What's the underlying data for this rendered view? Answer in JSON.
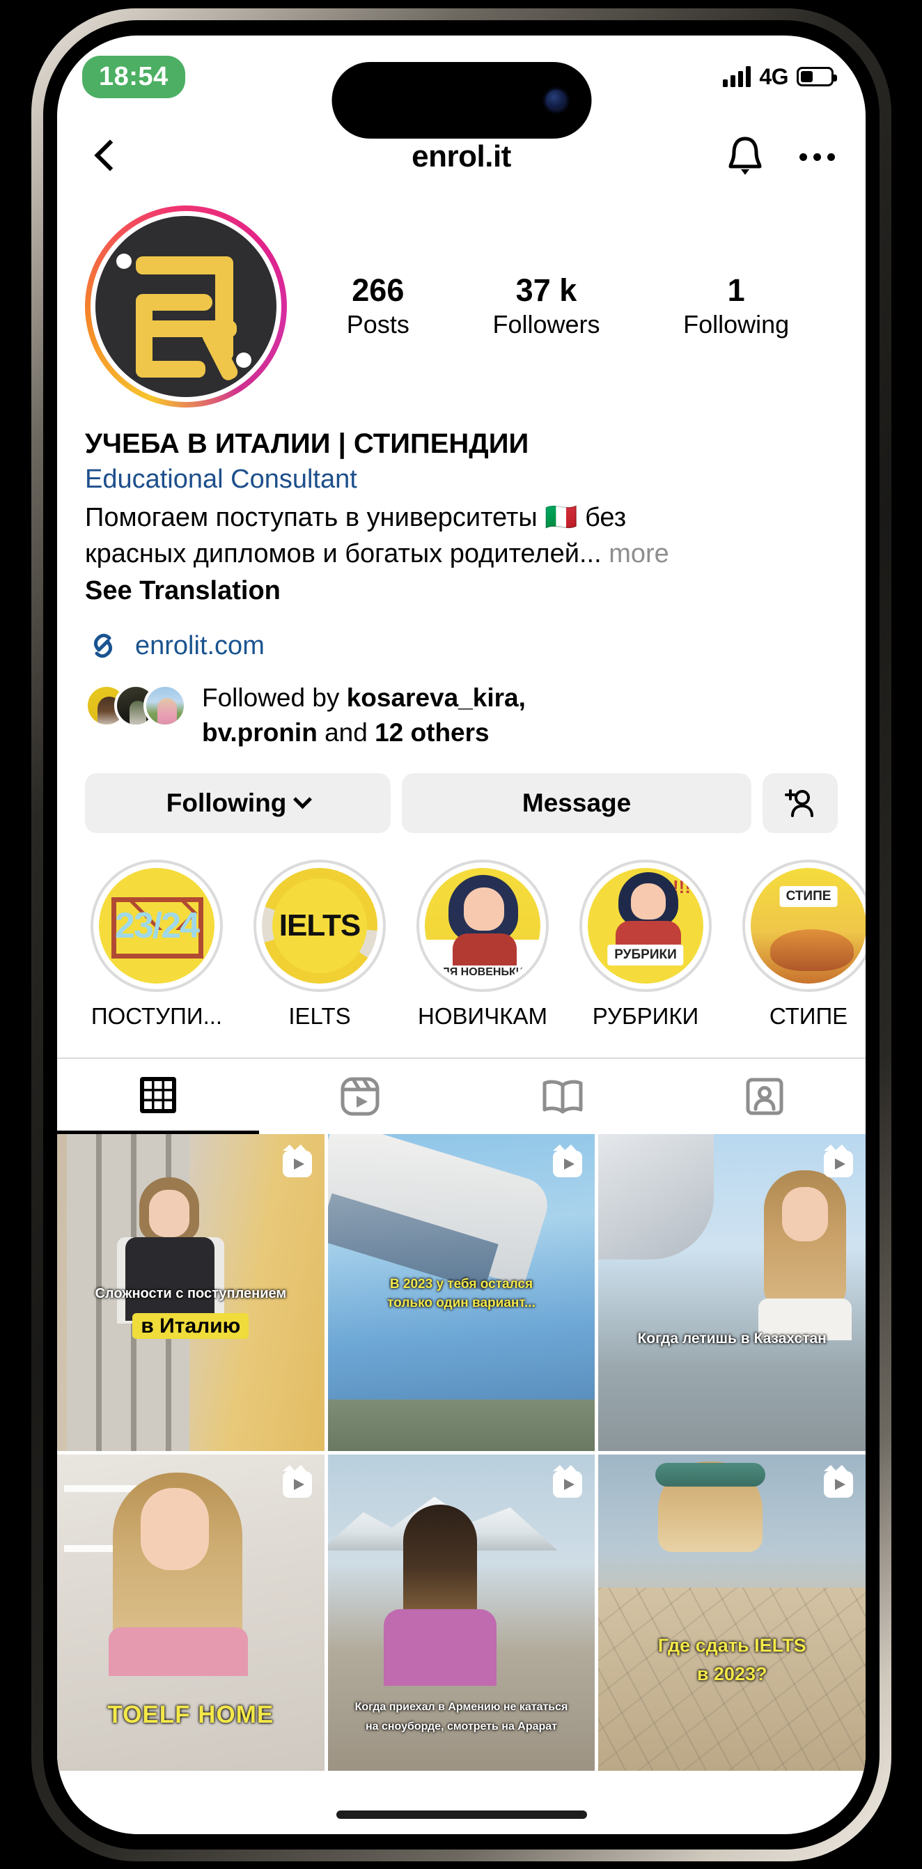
{
  "status_bar": {
    "time": "18:54",
    "network": "4G",
    "signal_icon": "signal-bars-icon",
    "battery_icon": "battery-icon"
  },
  "header": {
    "back_icon": "back-chevron-icon",
    "username": "enrol.it",
    "bell_icon": "bell-icon",
    "more_icon": "more-options-icon"
  },
  "profile": {
    "avatar_name": "enrol-it-avatar",
    "stats": [
      {
        "value": "266",
        "label": "Posts"
      },
      {
        "value": "37 k",
        "label": "Followers"
      },
      {
        "value": "1",
        "label": "Following"
      }
    ],
    "display_name": "УЧЕБА В ИТАЛИИ | СТИПЕНДИИ",
    "category": "Educational Consultant",
    "bio_line1": "Помогаем поступать в университеты 🇮🇹 без",
    "bio_line2": "красных дипломов и богатых родителей...",
    "bio_more": " more",
    "see_translation": "See Translation",
    "link_icon": "link-icon",
    "link_text": "enrolit.com",
    "followed_by_prefix": "Followed by ",
    "followed_by_names": "kosareva_kira, bv.pronin",
    "followed_by_and": " and ",
    "followed_by_others": "12 others"
  },
  "actions": {
    "following_label": "Following",
    "following_chevron": "chevron-down-icon",
    "message_label": "Message",
    "add_person_icon": "add-person-icon"
  },
  "highlights": [
    {
      "label": "ПОСТУПИ...",
      "art": "23/24"
    },
    {
      "label": "IELTS",
      "art": "IELTS"
    },
    {
      "label": "НОВИЧКАМ",
      "art": "ДЛЯ НОВЕНЬКИХ"
    },
    {
      "label": "РУБРИКИ",
      "art": "РУБРИКИ"
    },
    {
      "label": "СТИПЕ",
      "art": "СТИПЕ"
    }
  ],
  "tabs": [
    {
      "name": "grid",
      "icon": "grid-icon",
      "active": true
    },
    {
      "name": "reels",
      "icon": "reels-icon",
      "active": false
    },
    {
      "name": "guides",
      "icon": "guides-icon",
      "active": false
    },
    {
      "name": "tagged",
      "icon": "tagged-user-icon",
      "active": false
    }
  ],
  "posts": [
    {
      "caption_line1": "Сложности с поступлением",
      "caption_line2": "в Италию",
      "is_reel": true
    },
    {
      "caption_line1": "В 2023 у тебя остался",
      "caption_line2": "только один вариант...",
      "is_reel": true
    },
    {
      "caption_line1": "Когда летишь в Казахстан",
      "caption_line2": "",
      "is_reel": true
    },
    {
      "caption_line1": "TOELF HOME",
      "caption_line2": "",
      "is_reel": true
    },
    {
      "caption_line1": "Когда приехал в Армению не кататься",
      "caption_line2": "на сноуборде, смотреть на Арарат",
      "is_reel": true
    },
    {
      "caption_line1": "Где сдать IELTS",
      "caption_line2": "в 2023?",
      "is_reel": true
    }
  ],
  "colors": {
    "accent_blue": "#1a5490",
    "highlight_yellow": "#f5dc3c",
    "button_gray": "#efefef",
    "status_green": "#4caf63"
  }
}
